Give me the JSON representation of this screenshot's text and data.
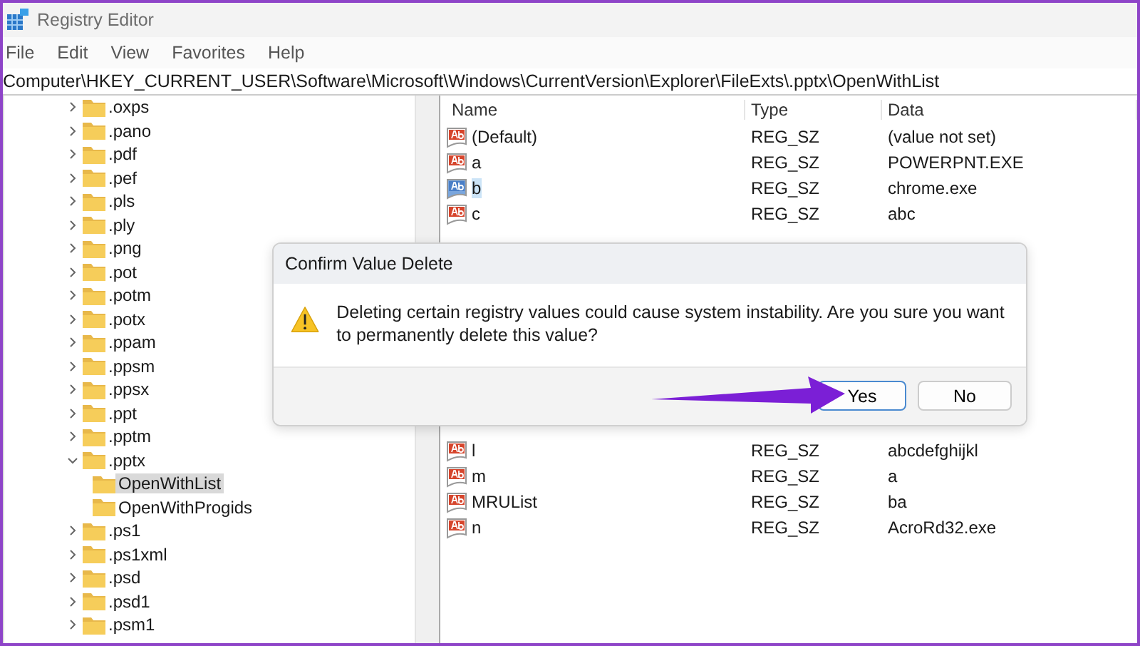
{
  "window": {
    "title": "Registry Editor"
  },
  "menu": [
    "File",
    "Edit",
    "View",
    "Favorites",
    "Help"
  ],
  "address": "Computer\\HKEY_CURRENT_USER\\Software\\Microsoft\\Windows\\CurrentVersion\\Explorer\\FileExts\\.pptx\\OpenWithList",
  "tree": [
    {
      "label": ".oxps",
      "expanded": false
    },
    {
      "label": ".pano",
      "expanded": false
    },
    {
      "label": ".pdf",
      "expanded": false
    },
    {
      "label": ".pef",
      "expanded": false
    },
    {
      "label": ".pls",
      "expanded": false
    },
    {
      "label": ".ply",
      "expanded": false
    },
    {
      "label": ".png",
      "expanded": false
    },
    {
      "label": ".pot",
      "expanded": false
    },
    {
      "label": ".potm",
      "expanded": false
    },
    {
      "label": ".potx",
      "expanded": false
    },
    {
      "label": ".ppam",
      "expanded": false
    },
    {
      "label": ".ppsm",
      "expanded": false
    },
    {
      "label": ".ppsx",
      "expanded": false
    },
    {
      "label": ".ppt",
      "expanded": false
    },
    {
      "label": ".pptm",
      "expanded": false
    },
    {
      "label": ".pptx",
      "expanded": true,
      "children": [
        {
          "label": "OpenWithList",
          "selected": true
        },
        {
          "label": "OpenWithProgids",
          "selected": false
        }
      ]
    },
    {
      "label": ".ps1",
      "expanded": false
    },
    {
      "label": ".ps1xml",
      "expanded": false
    },
    {
      "label": ".psd",
      "expanded": false
    },
    {
      "label": ".psd1",
      "expanded": false
    },
    {
      "label": ".psm1",
      "expanded": false
    }
  ],
  "values": {
    "columns": [
      "Name",
      "Type",
      "Data"
    ],
    "rows_top": [
      {
        "name": "(Default)",
        "type": "REG_SZ",
        "data": "(value not set)",
        "selected": false
      },
      {
        "name": "a",
        "type": "REG_SZ",
        "data": "POWERPNT.EXE",
        "selected": false
      },
      {
        "name": "b",
        "type": "REG_SZ",
        "data": "chrome.exe",
        "selected": true
      },
      {
        "name": "c",
        "type": "REG_SZ",
        "data": "abc",
        "selected": false
      }
    ],
    "rows_bottom": [
      {
        "name": "l",
        "type": "REG_SZ",
        "data": "abcdefghijkl",
        "selected": false
      },
      {
        "name": "m",
        "type": "REG_SZ",
        "data": "a",
        "selected": false
      },
      {
        "name": "MRUList",
        "type": "REG_SZ",
        "data": "ba",
        "selected": false
      },
      {
        "name": "n",
        "type": "REG_SZ",
        "data": "AcroRd32.exe",
        "selected": false
      }
    ]
  },
  "dialog": {
    "title": "Confirm Value Delete",
    "message": "Deleting certain registry values could cause system instability. Are you sure you want to permanently delete this value?",
    "buttons": [
      {
        "label": "Yes",
        "selected": true
      },
      {
        "label": "No",
        "selected": false
      }
    ]
  }
}
